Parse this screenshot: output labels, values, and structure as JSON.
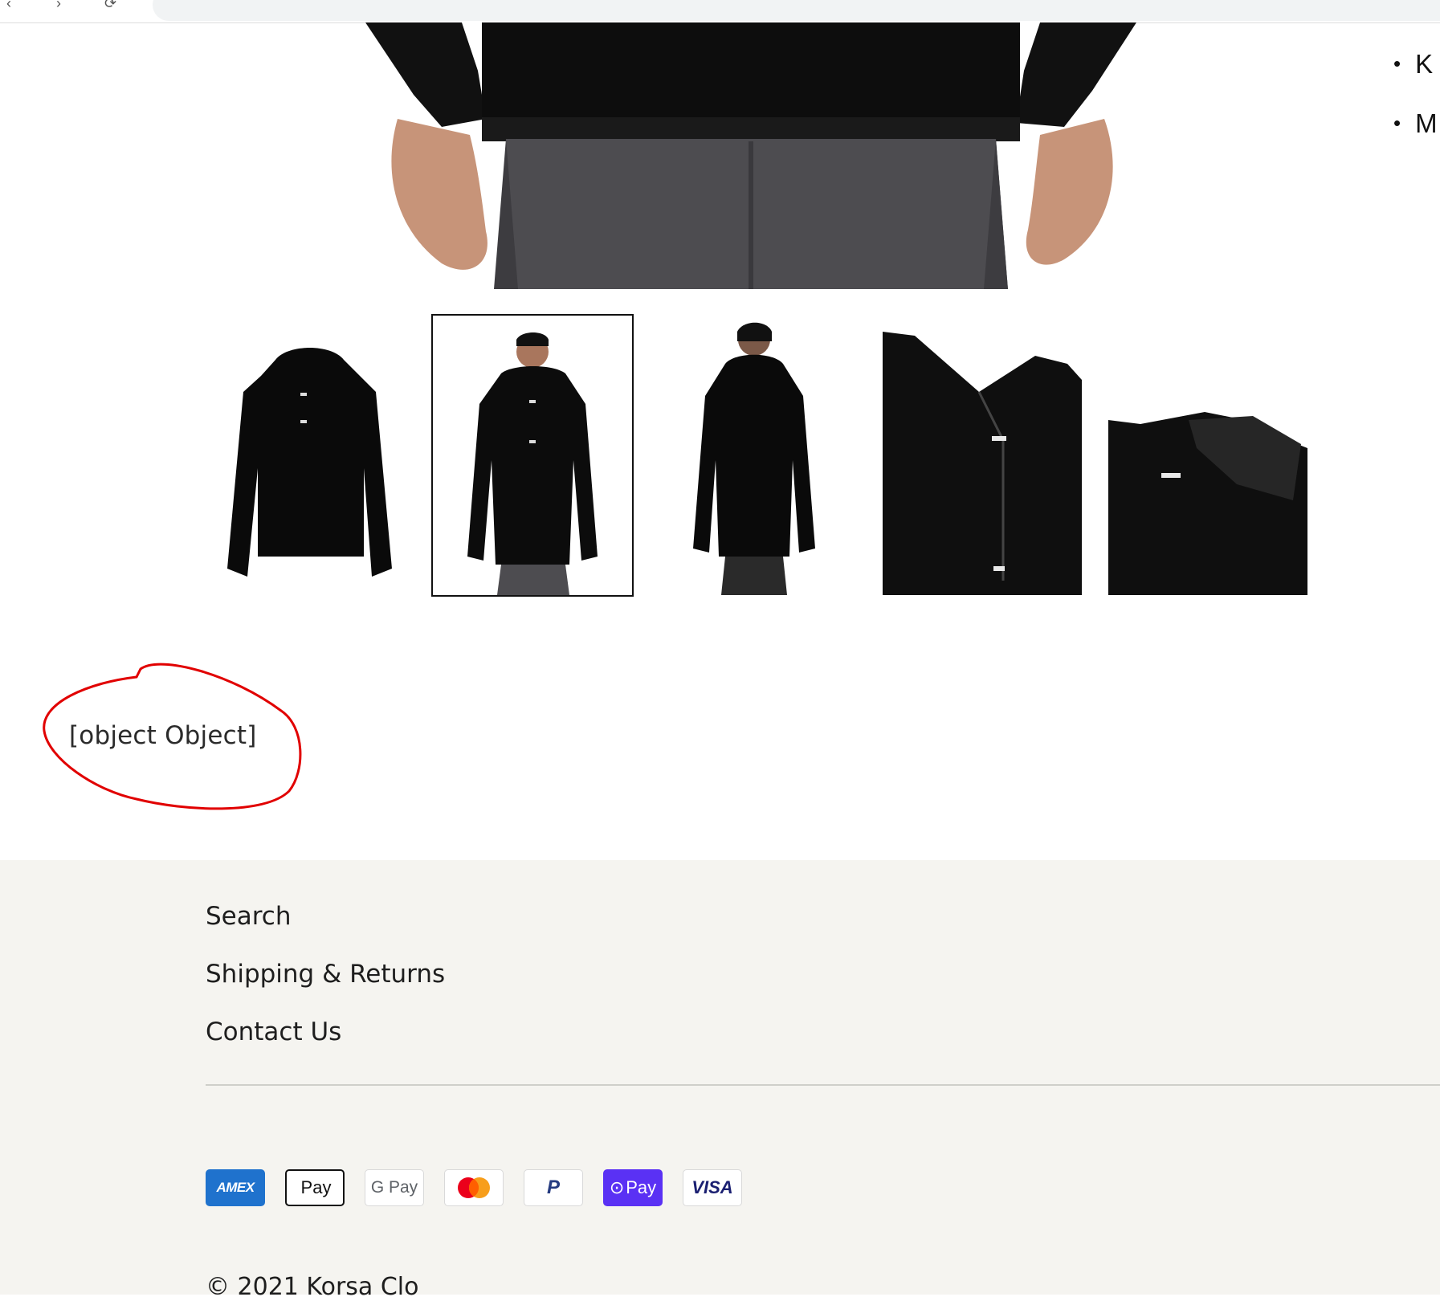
{
  "product": {
    "feature_bullets": [
      "K",
      "M"
    ]
  },
  "thumbnails": [
    {
      "label": "hoodie-flat-front"
    },
    {
      "label": "model-front"
    },
    {
      "label": "model-back"
    },
    {
      "label": "hood-detail"
    },
    {
      "label": "shoulder-detail"
    }
  ],
  "error_text": "[object Object]",
  "footer": {
    "links": [
      "Search",
      "Shipping & Returns",
      "Contact Us"
    ],
    "payment_methods": [
      {
        "name": "amex",
        "label": "AMEX"
      },
      {
        "name": "apple-pay",
        "label": "Pay"
      },
      {
        "name": "google-pay",
        "label": "G Pay"
      },
      {
        "name": "mastercard",
        "label": ""
      },
      {
        "name": "paypal",
        "label": "P"
      },
      {
        "name": "shop-pay",
        "label": "Pay"
      },
      {
        "name": "visa",
        "label": "VISA"
      }
    ],
    "copyright": "© 2021 Korsa Clo"
  },
  "colors": {
    "footer_bg": "#f5f4f0",
    "annotation_red": "#e10000",
    "amex_blue": "#1f72cd",
    "shop_pay_purple": "#5a31f4"
  }
}
